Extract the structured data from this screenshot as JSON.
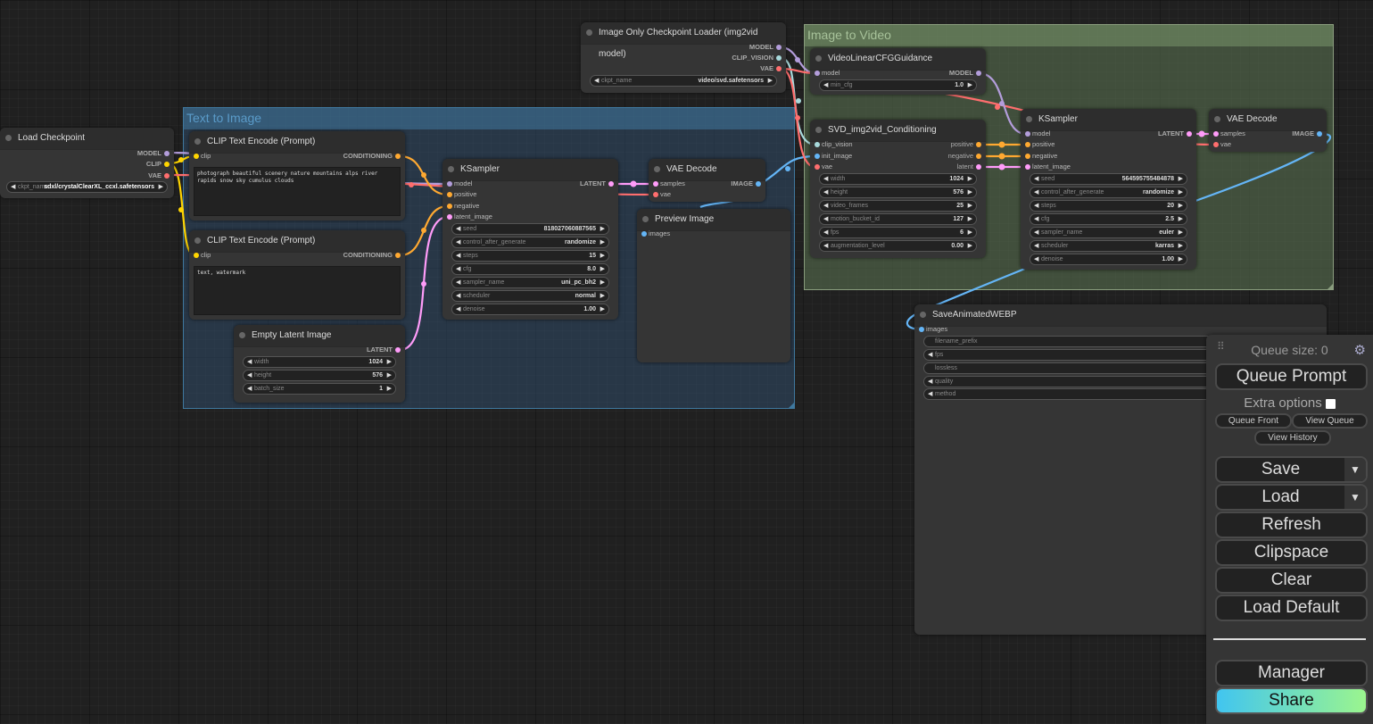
{
  "groups": {
    "text_to_image": {
      "title": "Text to Image",
      "color": "#3f789e"
    },
    "image_to_video": {
      "title": "Image to Video",
      "color": "#8a9d7e"
    }
  },
  "nodes": {
    "load_checkpoint": {
      "title": "Load Checkpoint",
      "outputs": [
        "MODEL",
        "CLIP",
        "VAE"
      ],
      "widgets": [
        {
          "label": "ckpt_name",
          "value": "sdxl/crystalClearXL_ccxl.safetensors"
        }
      ]
    },
    "clip_pos": {
      "title": "CLIP Text Encode (Prompt)",
      "inputs": [
        "clip"
      ],
      "outputs": [
        "CONDITIONING"
      ],
      "text": "photograph beautiful scenery nature mountains alps river rapids snow sky cumulus clouds"
    },
    "clip_neg": {
      "title": "CLIP Text Encode (Prompt)",
      "inputs": [
        "clip"
      ],
      "outputs": [
        "CONDITIONING"
      ],
      "text": "text, watermark"
    },
    "empty_latent": {
      "title": "Empty Latent Image",
      "outputs": [
        "LATENT"
      ],
      "widgets": [
        {
          "label": "width",
          "value": "1024"
        },
        {
          "label": "height",
          "value": "576"
        },
        {
          "label": "batch_size",
          "value": "1"
        }
      ]
    },
    "ksampler1": {
      "title": "KSampler",
      "inputs": [
        "model",
        "positive",
        "negative",
        "latent_image"
      ],
      "outputs": [
        "LATENT"
      ],
      "widgets": [
        {
          "label": "seed",
          "value": "818027060887565"
        },
        {
          "label": "control_after_generate",
          "value": "randomize"
        },
        {
          "label": "steps",
          "value": "15"
        },
        {
          "label": "cfg",
          "value": "8.0"
        },
        {
          "label": "sampler_name",
          "value": "uni_pc_bh2"
        },
        {
          "label": "scheduler",
          "value": "normal"
        },
        {
          "label": "denoise",
          "value": "1.00"
        }
      ]
    },
    "vae_decode1": {
      "title": "VAE Decode",
      "inputs": [
        "samples",
        "vae"
      ],
      "outputs": [
        "IMAGE"
      ]
    },
    "preview_image": {
      "title": "Preview Image",
      "inputs": [
        "images"
      ]
    },
    "img_only_loader": {
      "title": "Image Only Checkpoint Loader (img2vid model)",
      "outputs": [
        "MODEL",
        "CLIP_VISION",
        "VAE"
      ],
      "widgets": [
        {
          "label": "ckpt_name",
          "value": "video/svd.safetensors"
        }
      ]
    },
    "video_cfg": {
      "title": "VideoLinearCFGGuidance",
      "inputs": [
        "model"
      ],
      "outputs": [
        "MODEL"
      ],
      "widgets": [
        {
          "label": "min_cfg",
          "value": "1.0"
        }
      ]
    },
    "svd_cond": {
      "title": "SVD_img2vid_Conditioning",
      "inputs": [
        "clip_vision",
        "init_image",
        "vae"
      ],
      "outputs": [
        "positive",
        "negative",
        "latent"
      ],
      "widgets": [
        {
          "label": "width",
          "value": "1024"
        },
        {
          "label": "height",
          "value": "576"
        },
        {
          "label": "video_frames",
          "value": "25"
        },
        {
          "label": "motion_bucket_id",
          "value": "127"
        },
        {
          "label": "fps",
          "value": "6"
        },
        {
          "label": "augmentation_level",
          "value": "0.00"
        }
      ]
    },
    "ksampler2": {
      "title": "KSampler",
      "inputs": [
        "model",
        "positive",
        "negative",
        "latent_image"
      ],
      "outputs": [
        "LATENT"
      ],
      "widgets": [
        {
          "label": "seed",
          "value": "564595755484878"
        },
        {
          "label": "control_after_generate",
          "value": "randomize"
        },
        {
          "label": "steps",
          "value": "20"
        },
        {
          "label": "cfg",
          "value": "2.5"
        },
        {
          "label": "sampler_name",
          "value": "euler"
        },
        {
          "label": "scheduler",
          "value": "karras"
        },
        {
          "label": "denoise",
          "value": "1.00"
        }
      ]
    },
    "vae_decode2": {
      "title": "VAE Decode",
      "inputs": [
        "samples",
        "vae"
      ],
      "outputs": [
        "IMAGE"
      ]
    },
    "save_webp": {
      "title": "SaveAnimatedWEBP",
      "inputs": [
        "images"
      ],
      "widgets": [
        {
          "label": "filename_prefix"
        },
        {
          "label": "fps"
        },
        {
          "label": "lossless"
        },
        {
          "label": "quality"
        },
        {
          "label": "method"
        }
      ]
    }
  },
  "slot_colors": {
    "MODEL": "#b39ddb",
    "CLIP": "#ffd500",
    "VAE": "#ff6e6e",
    "CONDITIONING": "#ffa931",
    "LATENT": "#ff9cf9",
    "IMAGE": "#64b5f6",
    "CLIP_VISION": "#a8dadc"
  },
  "menu": {
    "queue_size": "Queue size: 0",
    "queue_prompt": "Queue Prompt",
    "extra_options": "Extra options",
    "extra_options_checked": false,
    "queue_front": "Queue Front",
    "view_queue": "View Queue",
    "view_history": "View History",
    "save": "Save",
    "load": "Load",
    "refresh": "Refresh",
    "clipspace": "Clipspace",
    "clear": "Clear",
    "load_default": "Load Default",
    "manager": "Manager",
    "share": "Share",
    "dropdown_glyph": "▼",
    "gear_glyph": "⚙",
    "drag_glyph": "⠿"
  }
}
